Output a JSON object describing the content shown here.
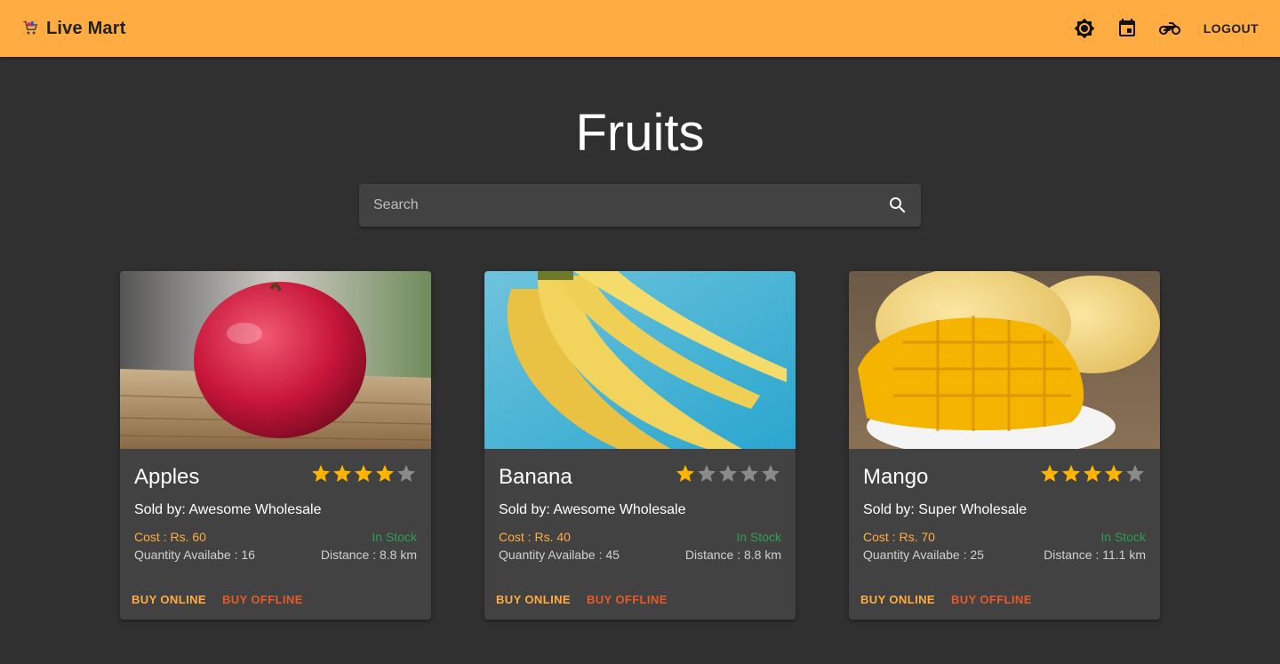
{
  "appbar": {
    "title": "Live Mart",
    "logo_icon": "shopping-cart-icon",
    "actions": [
      {
        "icon": "brightness-icon"
      },
      {
        "icon": "calendar-icon"
      },
      {
        "icon": "motorcycle-icon"
      }
    ],
    "logout_label": "LOGOUT",
    "background": "#ffad42"
  },
  "page": {
    "title": "Fruits"
  },
  "search": {
    "placeholder": "Search",
    "value": "",
    "icon": "search-icon"
  },
  "colors": {
    "accent": "#ffad42",
    "offline": "#e55b2a",
    "in_stock": "#2e9e50",
    "star": "#ffb400",
    "star_empty": "#8a8a8a"
  },
  "products": [
    {
      "name": "Apples",
      "rating": 4,
      "rating_max": 5,
      "seller": "Sold by: Awesome Wholesale",
      "cost": "Cost : Rs. 60",
      "stock": "In Stock",
      "quantity": "Quantity Availabe : 16",
      "distance": "Distance : 8.8 km",
      "buy_online": "BUY ONLINE",
      "buy_offline": "BUY OFFLINE"
    },
    {
      "name": "Banana",
      "rating": 1,
      "rating_max": 5,
      "seller": "Sold by: Awesome Wholesale",
      "cost": "Cost : Rs. 40",
      "stock": "In Stock",
      "quantity": "Quantity Availabe : 45",
      "distance": "Distance : 8.8 km",
      "buy_online": "BUY ONLINE",
      "buy_offline": "BUY OFFLINE"
    },
    {
      "name": "Mango",
      "rating": 4,
      "rating_max": 5,
      "seller": "Sold by: Super Wholesale",
      "cost": "Cost : Rs. 70",
      "stock": "In Stock",
      "quantity": "Quantity Availabe : 25",
      "distance": "Distance : 11.1 km",
      "buy_online": "BUY ONLINE",
      "buy_offline": "BUY OFFLINE"
    }
  ]
}
